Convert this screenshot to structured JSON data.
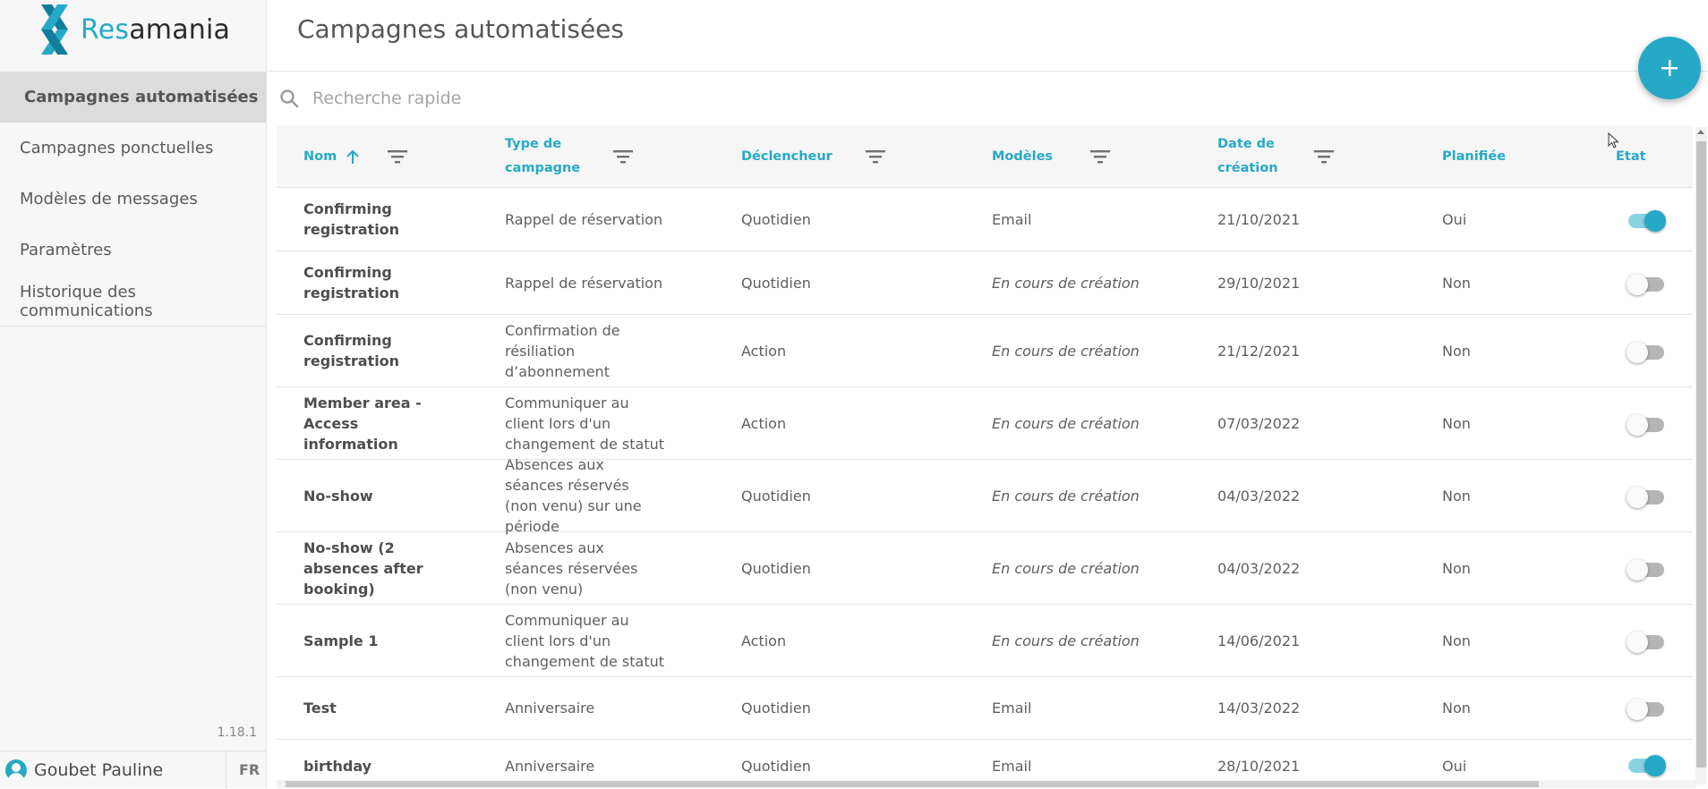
{
  "app": {
    "logo_prefix": "Res",
    "logo_suffix": "amania"
  },
  "sidebar": {
    "items": [
      {
        "label": "Campagnes automatisées",
        "active": true
      },
      {
        "label": "Campagnes ponctuelles",
        "active": false
      },
      {
        "label": "Modèles de messages",
        "active": false
      },
      {
        "label": "Paramètres",
        "active": false
      },
      {
        "label": "Historique des communications",
        "active": false
      }
    ],
    "version": "1.18.1",
    "user_name": "Goubet Pauline",
    "language": "FR"
  },
  "header": {
    "title": "Campagnes automatisées",
    "add_icon": "plus-icon"
  },
  "search": {
    "placeholder": "Recherche rapide",
    "value": ""
  },
  "table": {
    "columns": [
      {
        "label": "Nom",
        "sorted": "asc",
        "filter": true
      },
      {
        "label": "Type de campagne",
        "filter": true
      },
      {
        "label": "Déclencheur",
        "filter": true
      },
      {
        "label": "Modèles",
        "filter": true
      },
      {
        "label": "Date de création",
        "filter": true
      },
      {
        "label": "Planifiée",
        "filter": false
      },
      {
        "label": "Etat",
        "filter": false
      }
    ],
    "rows": [
      {
        "name": "Confirming registration",
        "type": "Rappel de réservation",
        "trigger": "Quotidien",
        "template": "Email",
        "template_italic": false,
        "date": "21/10/2021",
        "planned": "Oui",
        "active": true
      },
      {
        "name": "Confirming registration",
        "type": "Rappel de réservation",
        "trigger": "Quotidien",
        "template": "En cours de création",
        "template_italic": true,
        "date": "29/10/2021",
        "planned": "Non",
        "active": false
      },
      {
        "name": "Confirming registration",
        "type": "Confirmation de résiliation d’abonnement",
        "trigger": "Action",
        "template": "En cours de création",
        "template_italic": true,
        "date": "21/12/2021",
        "planned": "Non",
        "active": false
      },
      {
        "name": "Member area - Access information",
        "type": "Communiquer au client lors d'un changement de statut",
        "trigger": "Action",
        "template": "En cours de création",
        "template_italic": true,
        "date": "07/03/2022",
        "planned": "Non",
        "active": false
      },
      {
        "name": "No-show",
        "type": "Absences aux séances réservés (non venu) sur une période",
        "trigger": "Quotidien",
        "template": "En cours de création",
        "template_italic": true,
        "date": "04/03/2022",
        "planned": "Non",
        "active": false
      },
      {
        "name": "No-show (2 absences after booking)",
        "type": "Absences aux séances réservées (non venu)",
        "trigger": "Quotidien",
        "template": "En cours de création",
        "template_italic": true,
        "date": "04/03/2022",
        "planned": "Non",
        "active": false
      },
      {
        "name": "Sample 1",
        "type": "Communiquer au client lors d'un changement de statut",
        "trigger": "Action",
        "template": "En cours de création",
        "template_italic": true,
        "date": "14/06/2021",
        "planned": "Non",
        "active": false
      },
      {
        "name": "Test",
        "type": "Anniversaire",
        "trigger": "Quotidien",
        "template": "Email",
        "template_italic": false,
        "date": "14/03/2022",
        "planned": "Non",
        "active": false
      },
      {
        "name": "birthday",
        "type": "Anniversaire",
        "trigger": "Quotidien",
        "template": "Email",
        "template_italic": false,
        "date": "28/10/2021",
        "planned": "Oui",
        "active": true
      }
    ]
  },
  "colors": {
    "accent": "#26a9c7",
    "sidebar_bg": "#f7f7f7",
    "active_item_bg": "#dcdcdc",
    "header_bg": "#f6f6f6"
  }
}
